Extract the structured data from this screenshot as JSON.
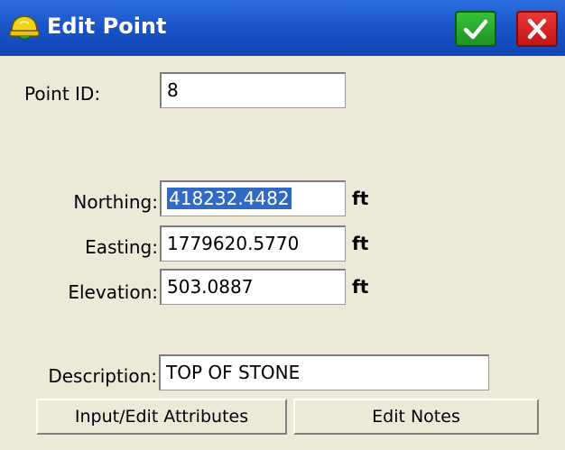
{
  "window": {
    "title": "Edit Point"
  },
  "icons": {
    "app": "hardhat-icon",
    "ok": "checkmark-icon",
    "close": "close-icon"
  },
  "colors": {
    "titlebar": "#1b55c8",
    "ok_button": "#23a12a",
    "close_button": "#d42020",
    "selection": "#316ac5"
  },
  "point": {
    "id_label": "Point ID:",
    "id_value": "8"
  },
  "coords": {
    "northing_label": "Northing:",
    "northing_value": "418232.4482",
    "easting_label": "Easting:",
    "easting_value": "1779620.5770",
    "elevation_label": "Elevation:",
    "elevation_value": "503.0887",
    "unit": "ft"
  },
  "description": {
    "label": "Description:",
    "value": "TOP OF STONE"
  },
  "buttons": {
    "attributes": "Input/Edit Attributes",
    "notes": "Edit Notes"
  }
}
